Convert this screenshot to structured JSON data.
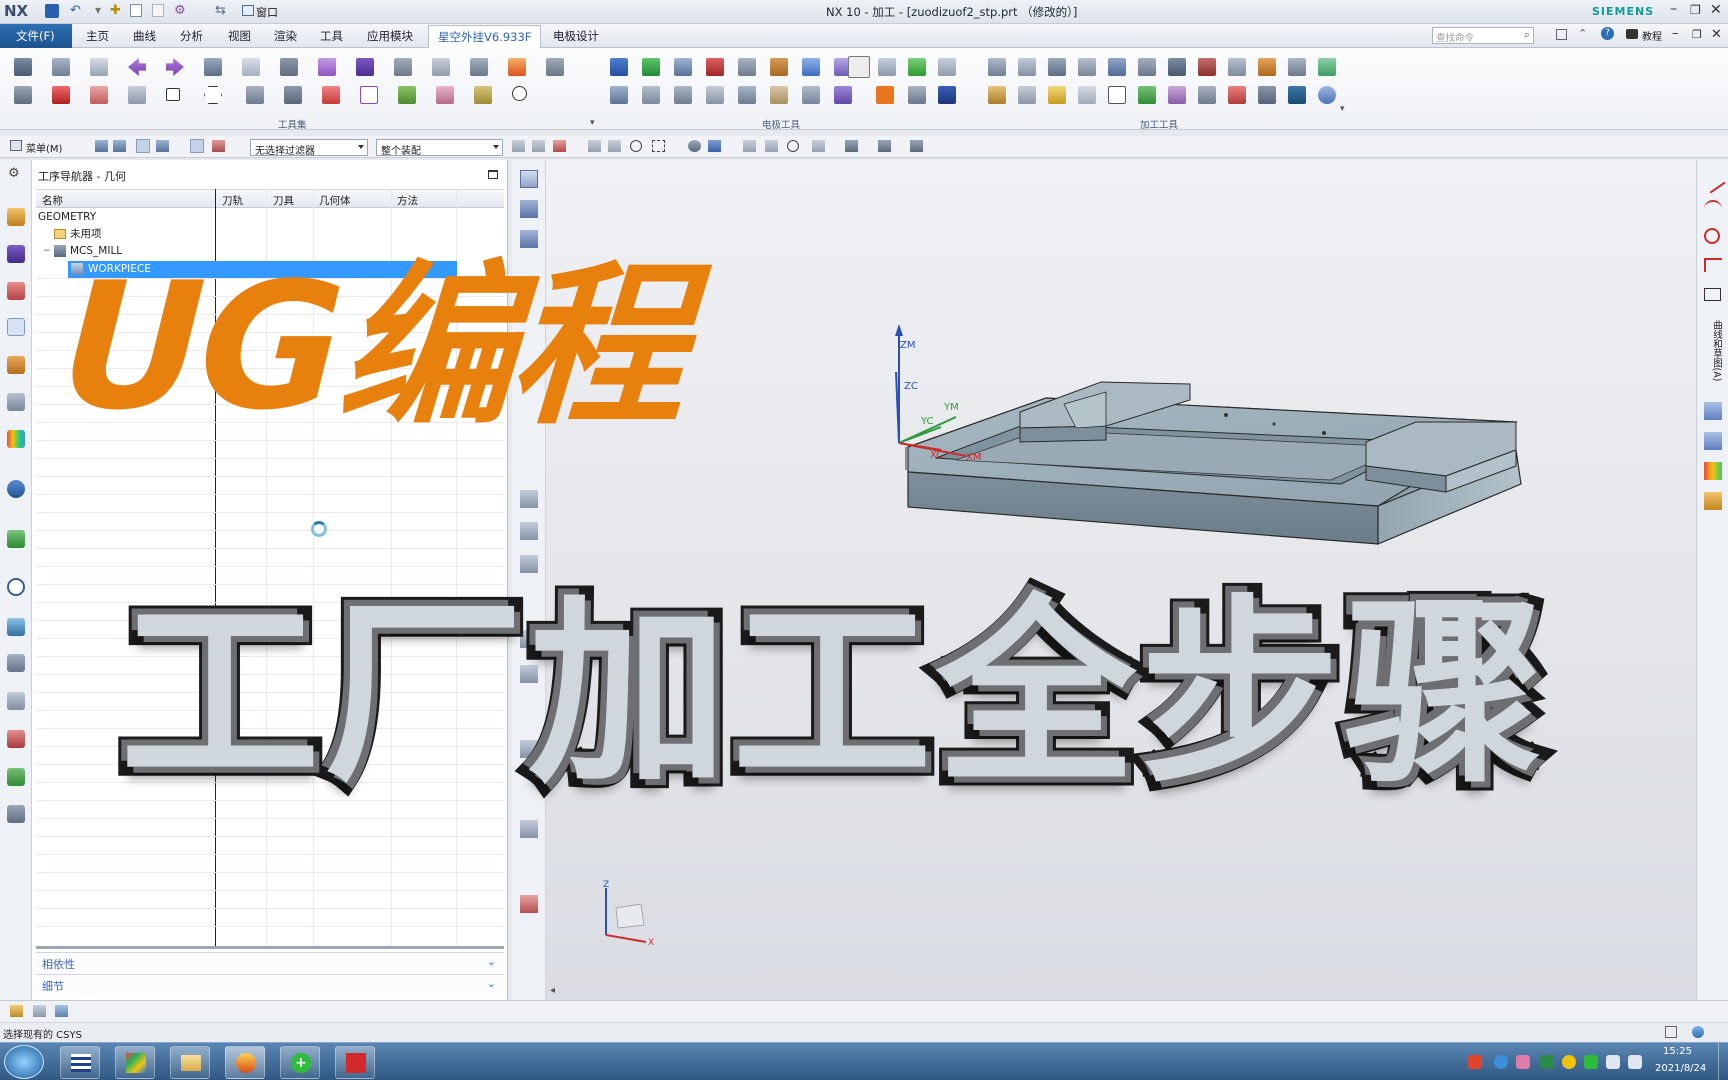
{
  "titlebar": {
    "logo": "NX",
    "window_menu_label": "窗口",
    "title": "NX 10 - 加工 - [zuodizuof2_stp.prt （修改的）]",
    "brand": "SIEMENS",
    "brand_color": "#009999"
  },
  "menu": {
    "file_label": "文件(F)",
    "tabs": [
      "主页",
      "曲线",
      "分析",
      "视图",
      "渲染",
      "工具",
      "应用模块",
      "星空外挂V6.933F",
      "电极设计"
    ],
    "active_tab": "星空外挂V6.933F",
    "search_placeholder": "查找命令",
    "help_label": "教程"
  },
  "ribbon": {
    "groups": [
      "工具集",
      "电极工具",
      "加工工具"
    ]
  },
  "selection_bar": {
    "menu_label": "菜单(M)",
    "filter_value": "无选择过滤器",
    "scope_value": "整个装配"
  },
  "navigator": {
    "title": "工序导航器 - 几何",
    "columns": [
      "名称",
      "刀轨",
      "刀具",
      "几何体",
      "方法"
    ],
    "rows": [
      "GEOMETRY",
      "未用项",
      "MCS_MILL",
      "WORKPIECE"
    ],
    "sections": [
      "相依性",
      "细节"
    ]
  },
  "viewport": {
    "axis_labels": {
      "zm": "ZM",
      "zc": "ZC",
      "ym": "YM",
      "yc": "YC",
      "xc": "XC",
      "xm": "XM"
    },
    "triad_labels": {
      "z": "Z",
      "x": "X"
    },
    "part_color": "#8fa2ad"
  },
  "overlay": {
    "title_top": "UG编程",
    "title_bottom": "工厂加工全步骤",
    "title_top_color": "#e8800d"
  },
  "rightbar": {
    "vertical_label": "曲线和草图(A)"
  },
  "status": {
    "message": "选择现有的 CSYS"
  },
  "taskbar": {
    "time": "15:25",
    "date": "2021/8/24"
  }
}
